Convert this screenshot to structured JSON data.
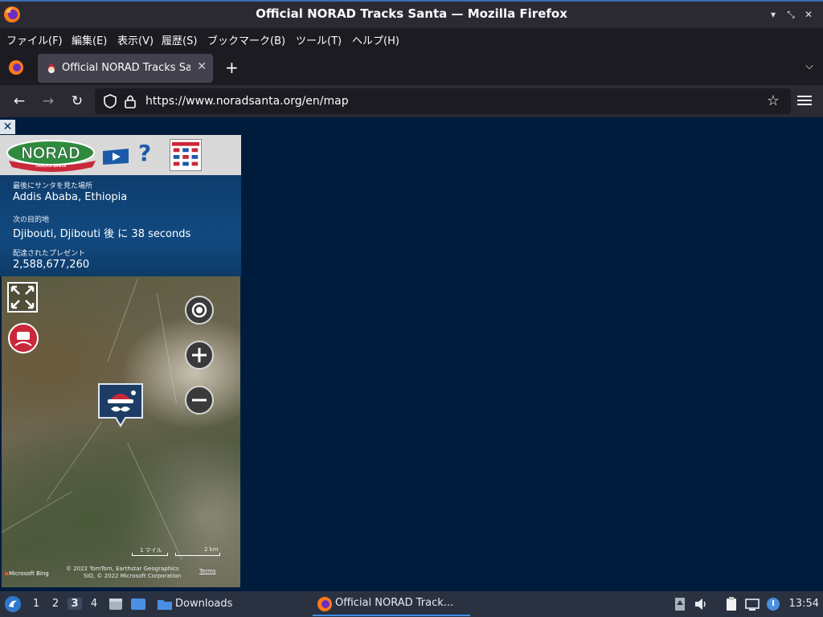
{
  "window": {
    "title": "Official NORAD Tracks Santa — Mozilla Firefox",
    "controls": [
      "minimize",
      "restore",
      "close"
    ]
  },
  "menu": {
    "items": [
      "ファイル(F)",
      "編集(E)",
      "表示(V)",
      "履歴(S)",
      "ブックマーク(B)",
      "ツール(T)",
      "ヘルプ(H)"
    ]
  },
  "tabs": {
    "active_label": "Official NORAD Tracks Santa",
    "close_glyph": "✕",
    "new_tab_glyph": "+",
    "list_glyph": "⌵"
  },
  "nav": {
    "url": "https://www.noradsanta.org/en/map",
    "back_glyph": "←",
    "forward_glyph": "→",
    "reload_glyph": "↻",
    "star_glyph": "☆"
  },
  "panel": {
    "close_glyph": "✕",
    "logo_text": "NORAD",
    "logo_subtext": "TRACKS  SANTA",
    "help_glyph": "?",
    "last_seen_label": "最後にサンタを見た場所",
    "last_seen_value": "Addis Ababa, Ethiopia",
    "next_stop_label": "次の目的地",
    "next_stop_value": "Djibouti, Djibouti 後 に 38 seconds",
    "presents_label": "配達されたプレゼント",
    "presents_value": "2,588,677,260"
  },
  "map": {
    "scale_mi": "1 マイル",
    "scale_km": "2 km",
    "attribution_line1": "© 2022 TomTom, Earthstar Geographics",
    "attribution_line2": "SIO, © 2022 Microsoft Corporation",
    "terms": "Terms",
    "brand": "Microsoft Bing"
  },
  "taskbar": {
    "workspaces": [
      "1",
      "2",
      "3",
      "4"
    ],
    "active_workspace": "3",
    "downloads_label": "Downloads",
    "active_task_label": "Official NORAD Track...",
    "clock": "13:54"
  }
}
